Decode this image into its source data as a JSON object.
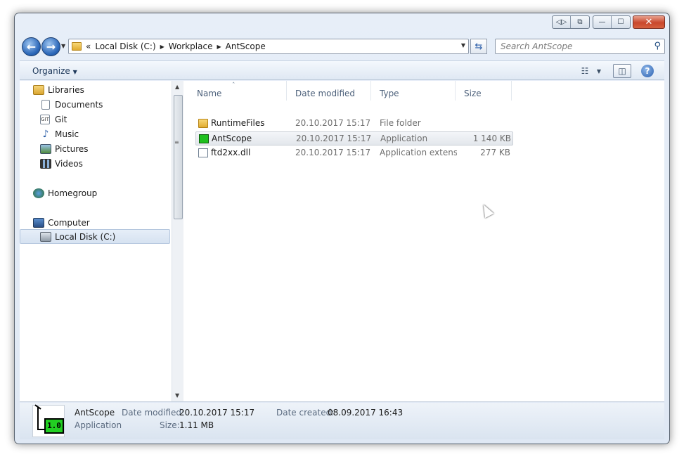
{
  "window": {
    "caption_buttons": {
      "close_glyph": "✕",
      "minimize_glyph": "—",
      "maximize_glyph": "☐"
    }
  },
  "address_bar": {
    "overflow_glyph": "«",
    "breadcrumbs": [
      "Local Disk (C:)",
      "Workplace",
      "AntScope"
    ],
    "search_placeholder": "Search AntScope"
  },
  "toolbar": {
    "organize_label": "Organize",
    "help_glyph": "?"
  },
  "nav_pane": {
    "items": [
      {
        "label": "Libraries",
        "icon": "library-icon"
      },
      {
        "label": "Documents",
        "icon": "documents-icon"
      },
      {
        "label": "Git",
        "icon": "git-icon"
      },
      {
        "label": "Music",
        "icon": "music-icon"
      },
      {
        "label": "Pictures",
        "icon": "pictures-icon"
      },
      {
        "label": "Videos",
        "icon": "videos-icon"
      },
      {
        "label": "Homegroup",
        "icon": "homegroup-icon"
      },
      {
        "label": "Computer",
        "icon": "computer-icon"
      },
      {
        "label": "Local Disk (C:)",
        "icon": "local-disk-icon"
      }
    ],
    "selected": "Local Disk (C:)"
  },
  "file_list": {
    "columns": [
      "Name",
      "Date modified",
      "Type",
      "Size"
    ],
    "rows": [
      {
        "name": "RuntimeFiles",
        "date": "20.10.2017 15:17",
        "type": "File folder",
        "size": "",
        "icon": "folder-icon"
      },
      {
        "name": "AntScope",
        "date": "20.10.2017 15:17",
        "type": "Application",
        "size": "1 140 KB",
        "icon": "application-icon"
      },
      {
        "name": "ftd2xx.dll",
        "date": "20.10.2017 15:17",
        "type": "Application extens...",
        "size": "277 KB",
        "icon": "dll-icon"
      }
    ],
    "selected_row": "AntScope"
  },
  "details_pane": {
    "name": "AntScope",
    "kind": "Application",
    "date_modified_label": "Date modified:",
    "date_modified": "20.10.2017 15:17",
    "date_created_label": "Date created:",
    "date_created": "08.09.2017 16:43",
    "size_label": "Size:",
    "size": "1.11 MB",
    "thumb_text": "1.0"
  }
}
